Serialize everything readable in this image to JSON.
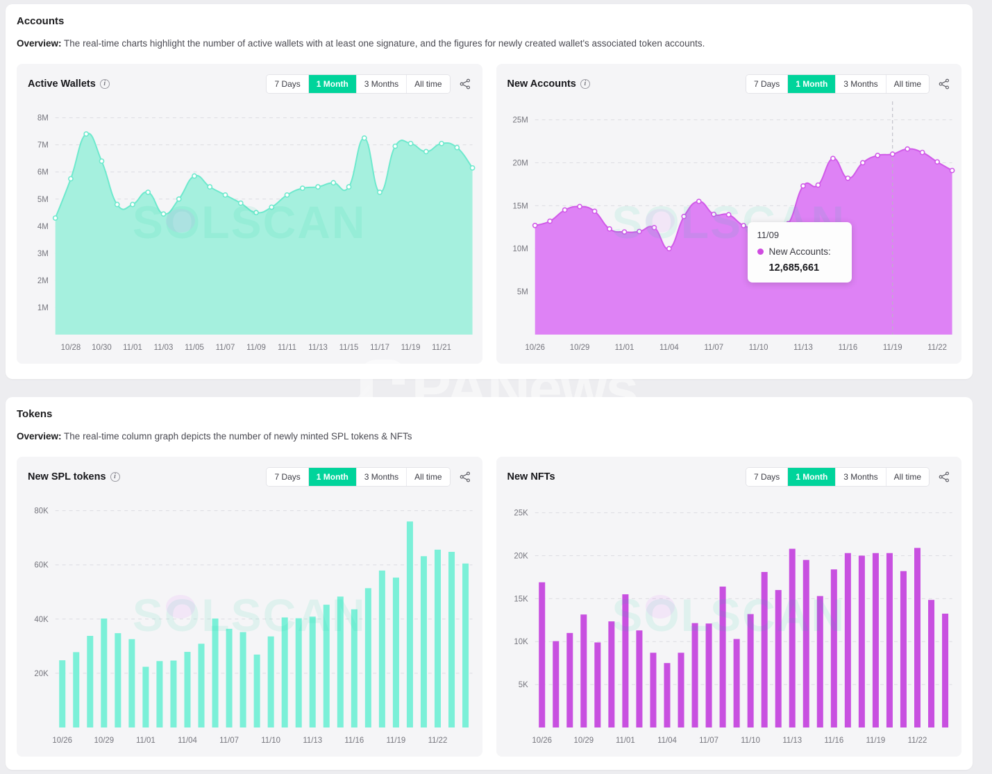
{
  "sections": [
    {
      "title": "Accounts",
      "overview_label": "Overview:",
      "overview_text": " The real-time charts highlight the number of active wallets with at least one signature, and the figures for newly created wallet's associated token accounts."
    },
    {
      "title": "Tokens",
      "overview_label": "Overview:",
      "overview_text": " The real-time column graph depicts the number of newly minted SPL tokens & NFTs"
    }
  ],
  "range_options": [
    "7 Days",
    "1 Month",
    "3 Months",
    "All time"
  ],
  "selected_range": "1 Month",
  "cards": {
    "active_wallets": {
      "title": "Active Wallets",
      "info_icon": "info-icon",
      "share_icon": "share-icon"
    },
    "new_accounts": {
      "title": "New Accounts",
      "info_icon": "info-icon",
      "share_icon": "share-icon"
    },
    "new_spl_tokens": {
      "title": "New SPL tokens",
      "info_icon": "info-icon",
      "share_icon": "share-icon"
    },
    "new_nfts": {
      "title": "New NFTs",
      "info_icon": "info-icon",
      "share_icon": "share-icon"
    }
  },
  "tooltip": {
    "date": "11/09",
    "series_label": "New Accounts:",
    "value": "12,685,661"
  },
  "watermarks": {
    "chart": "SOLSCAN",
    "overlay": "PANews"
  },
  "colors": {
    "accent_teal": "#00d49b",
    "area_teal_fill": "#a5f0de",
    "line_teal": "#6ee9cd",
    "bar_teal": "#7bf0d8",
    "area_purple_fill": "#de82f5",
    "line_purple": "#d05ae8",
    "bar_purple": "#c850e0",
    "page_bg": "#ededf0",
    "card_bg": "#ffffff",
    "chart_bg": "#f5f5f7"
  },
  "chart_data": [
    {
      "id": "active-wallets",
      "type": "area",
      "title": "Active Wallets",
      "xlabel": "",
      "ylabel": "",
      "ylim": [
        0,
        8400000
      ],
      "ytick_labels": [
        "1M",
        "2M",
        "3M",
        "4M",
        "5M",
        "6M",
        "7M",
        "8M"
      ],
      "ytick_values": [
        1000000,
        2000000,
        3000000,
        4000000,
        5000000,
        6000000,
        7000000,
        8000000
      ],
      "xtick_labels": [
        "10/28",
        "10/30",
        "11/01",
        "11/03",
        "11/05",
        "11/07",
        "11/09",
        "11/11",
        "11/13",
        "11/15",
        "11/17",
        "11/19",
        "11/21"
      ],
      "grid": true,
      "legend": "none",
      "categories": [
        "10/27",
        "10/28",
        "10/29",
        "10/30",
        "10/31",
        "11/01",
        "11/02",
        "11/03",
        "11/04",
        "11/05",
        "11/06",
        "11/07",
        "11/08",
        "11/09",
        "11/10",
        "11/11",
        "11/12",
        "11/13",
        "11/14",
        "11/15",
        "11/16",
        "11/17",
        "11/18",
        "11/19",
        "11/20",
        "11/21",
        "11/22",
        "11/23"
      ],
      "values": [
        4300000,
        5750000,
        7400000,
        6400000,
        4800000,
        4800000,
        5250000,
        4450000,
        5000000,
        5850000,
        5450000,
        5150000,
        4850000,
        4500000,
        4700000,
        5150000,
        5400000,
        5450000,
        5600000,
        5450000,
        7250000,
        5250000,
        6950000,
        7050000,
        6750000,
        7050000,
        6900000,
        6150000
      ]
    },
    {
      "id": "new-accounts",
      "type": "area",
      "title": "New Accounts",
      "xlabel": "",
      "ylabel": "",
      "ylim": [
        0,
        26500000
      ],
      "ytick_labels": [
        "5M",
        "10M",
        "15M",
        "20M",
        "25M"
      ],
      "ytick_values": [
        5000000,
        10000000,
        15000000,
        20000000,
        25000000
      ],
      "xtick_labels": [
        "10/26",
        "10/29",
        "11/01",
        "11/04",
        "11/07",
        "11/10",
        "11/13",
        "11/16",
        "11/19",
        "11/22"
      ],
      "grid": true,
      "legend": "none",
      "highlight_date": "11/09",
      "categories": [
        "10/26",
        "10/27",
        "10/28",
        "10/29",
        "10/30",
        "10/31",
        "11/01",
        "11/02",
        "11/03",
        "11/04",
        "11/05",
        "11/06",
        "11/07",
        "11/08",
        "11/09",
        "11/10",
        "11/11",
        "11/12",
        "11/13",
        "11/14",
        "11/15",
        "11/16",
        "11/17",
        "11/18",
        "11/19",
        "11/20",
        "11/21",
        "11/22",
        "11/23"
      ],
      "values": [
        12700000,
        13200000,
        14500000,
        14900000,
        14350000,
        12300000,
        11950000,
        12000000,
        12450000,
        10000000,
        13750000,
        15500000,
        14000000,
        13950000,
        12685661,
        12400000,
        12650000,
        12900000,
        17300000,
        17400000,
        20500000,
        18200000,
        20000000,
        20850000,
        21000000,
        21600000,
        21200000,
        20100000,
        19100000
      ]
    },
    {
      "id": "new-spl-tokens",
      "type": "bar",
      "title": "New SPL tokens",
      "xlabel": "",
      "ylabel": "",
      "ylim": [
        0,
        84000
      ],
      "ytick_labels": [
        "20K",
        "40K",
        "60K",
        "80K"
      ],
      "ytick_values": [
        20000,
        40000,
        60000,
        80000
      ],
      "xtick_labels": [
        "10/26",
        "10/29",
        "11/01",
        "11/04",
        "11/07",
        "11/10",
        "11/13",
        "11/16",
        "11/19",
        "11/22"
      ],
      "grid": true,
      "legend": "none",
      "categories": [
        "10/26",
        "10/27",
        "10/28",
        "10/29",
        "10/30",
        "10/31",
        "11/01",
        "11/02",
        "11/03",
        "11/04",
        "11/05",
        "11/06",
        "11/07",
        "11/08",
        "11/09",
        "11/10",
        "11/11",
        "11/12",
        "11/13",
        "11/14",
        "11/15",
        "11/16",
        "11/17",
        "11/18",
        "11/19",
        "11/20",
        "11/21",
        "11/22",
        "11/23"
      ],
      "values": [
        24800,
        27800,
        33800,
        40200,
        34800,
        32600,
        22400,
        24500,
        24700,
        27900,
        30900,
        40200,
        36400,
        35200,
        26900,
        33600,
        40600,
        40300,
        40900,
        45300,
        48300,
        43600,
        51400,
        57900,
        55300,
        76000,
        63200,
        65600,
        64800,
        60500
      ]
    },
    {
      "id": "new-nfts",
      "type": "bar",
      "title": "New NFTs",
      "xlabel": "",
      "ylabel": "",
      "ylim": [
        0,
        26500
      ],
      "ytick_labels": [
        "5K",
        "10K",
        "15K",
        "20K",
        "25K"
      ],
      "ytick_values": [
        5000,
        10000,
        15000,
        20000,
        25000
      ],
      "xtick_labels": [
        "10/26",
        "10/29",
        "11/01",
        "11/04",
        "11/07",
        "11/10",
        "11/13",
        "11/16",
        "11/19",
        "11/22"
      ],
      "grid": true,
      "legend": "none",
      "categories": [
        "10/26",
        "10/27",
        "10/28",
        "10/29",
        "10/30",
        "10/31",
        "11/01",
        "11/02",
        "11/03",
        "11/04",
        "11/05",
        "11/06",
        "11/07",
        "11/08",
        "11/09",
        "11/10",
        "11/11",
        "11/12",
        "11/13",
        "11/14",
        "11/15",
        "11/16",
        "11/17",
        "11/18",
        "11/19",
        "11/20",
        "11/21",
        "11/22",
        "11/23"
      ],
      "values": [
        16900,
        10050,
        11000,
        13150,
        9900,
        12350,
        15500,
        11300,
        8700,
        7500,
        8700,
        12150,
        12100,
        16400,
        10300,
        13200,
        18100,
        16000,
        20800,
        19500,
        15300,
        18400,
        20300,
        20000,
        20300,
        20300,
        18200,
        20900,
        14850,
        13250
      ]
    }
  ]
}
